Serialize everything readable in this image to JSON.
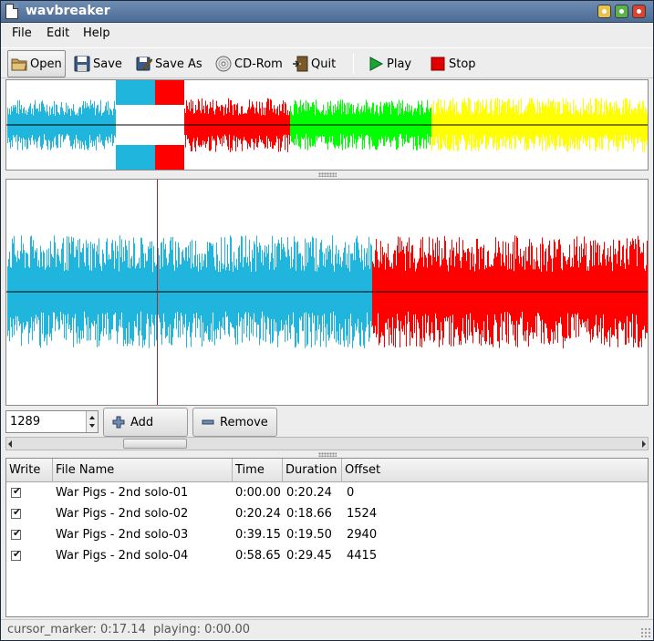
{
  "window": {
    "title": "wavbreaker"
  },
  "menu": {
    "file": "File",
    "edit": "Edit",
    "help": "Help"
  },
  "toolbar": {
    "open": "Open",
    "save": "Save",
    "save_as": "Save As",
    "cdrom": "CD-Rom",
    "quit": "Quit",
    "play": "Play",
    "stop": "Stop"
  },
  "colors": {
    "track1": "#1fb5dc",
    "track2": "#ff0000",
    "track3": "#00ff00",
    "track4": "#ffff00",
    "cursor": "#b22222"
  },
  "controls": {
    "position_value": "1289",
    "add_label": "Add",
    "remove_label": "Remove"
  },
  "table": {
    "headers": [
      "Write",
      "File Name",
      "Time",
      "Duration",
      "Offset"
    ],
    "rows": [
      {
        "write": true,
        "name": "War Pigs - 2nd solo-01",
        "time": "0:00.00",
        "duration": "0:20.24",
        "offset": "0"
      },
      {
        "write": true,
        "name": "War Pigs - 2nd solo-02",
        "time": "0:20.24",
        "duration": "0:18.66",
        "offset": "1524"
      },
      {
        "write": true,
        "name": "War Pigs - 2nd solo-03",
        "time": "0:39.15",
        "duration": "0:19.50",
        "offset": "2940"
      },
      {
        "write": true,
        "name": "War Pigs - 2nd solo-04",
        "time": "0:58.65",
        "duration": "0:29.45",
        "offset": "4415"
      }
    ]
  },
  "status": {
    "cursor": "cursor_marker: 0:17.14",
    "playing": "playing: 0:00.00"
  }
}
